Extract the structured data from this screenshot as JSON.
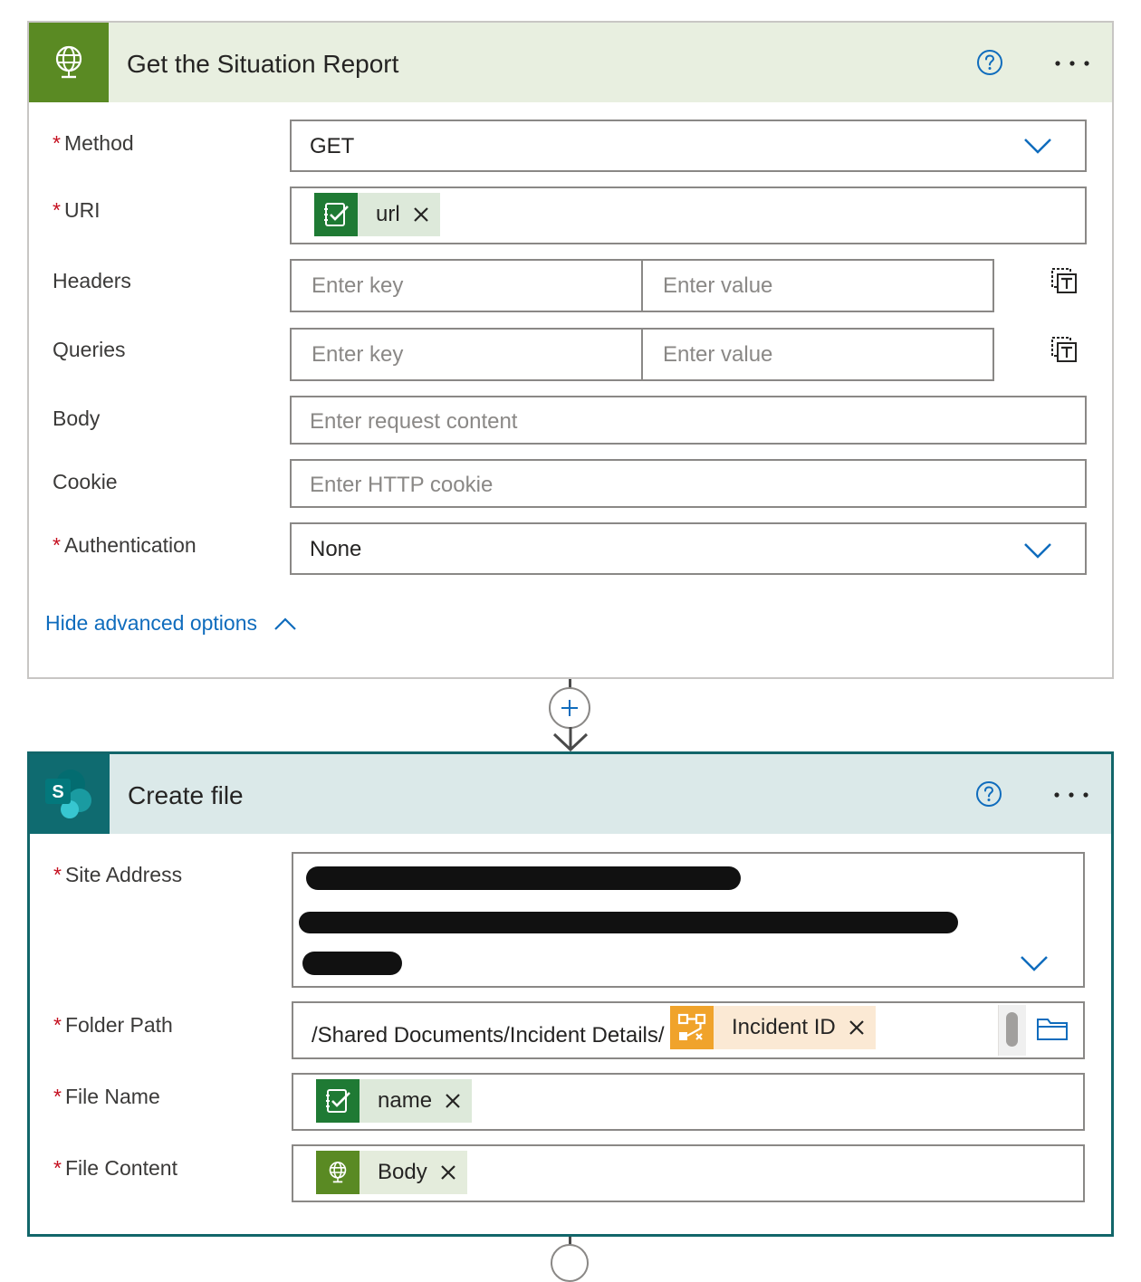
{
  "http_action": {
    "title": "Get the Situation Report",
    "fields": {
      "method": {
        "label": "Method",
        "required": true,
        "value": "GET"
      },
      "uri": {
        "label": "URI",
        "required": true,
        "token": "url"
      },
      "headers": {
        "label": "Headers",
        "key_placeholder": "Enter key",
        "value_placeholder": "Enter value"
      },
      "queries": {
        "label": "Queries",
        "key_placeholder": "Enter key",
        "value_placeholder": "Enter value"
      },
      "body": {
        "label": "Body",
        "placeholder": "Enter request content"
      },
      "cookie": {
        "label": "Cookie",
        "placeholder": "Enter HTTP cookie"
      },
      "authentication": {
        "label": "Authentication",
        "required": true,
        "value": "None"
      }
    },
    "advanced_toggle": "Hide advanced options"
  },
  "create_file_action": {
    "title": "Create file",
    "fields": {
      "site_address": {
        "label": "Site Address",
        "required": true
      },
      "folder_path": {
        "label": "Folder Path",
        "required": true,
        "prefix": "/Shared Documents/Incident Details/",
        "token": "Incident ID"
      },
      "file_name": {
        "label": "File Name",
        "required": true,
        "token": "name"
      },
      "file_content": {
        "label": "File Content",
        "required": true,
        "token": "Body"
      }
    }
  },
  "icons": {
    "http": "globe-icon",
    "sharepoint": "sharepoint-icon",
    "variable": "variable-icon",
    "workflow": "workflow-icon"
  },
  "colors": {
    "http_accent": "#5a8a23",
    "sharepoint_accent": "#0f6b70",
    "link": "#0f6cbd",
    "required": "#c50f1f",
    "variable_token": "#1f7a34",
    "workflow_token": "#f0a32b"
  }
}
